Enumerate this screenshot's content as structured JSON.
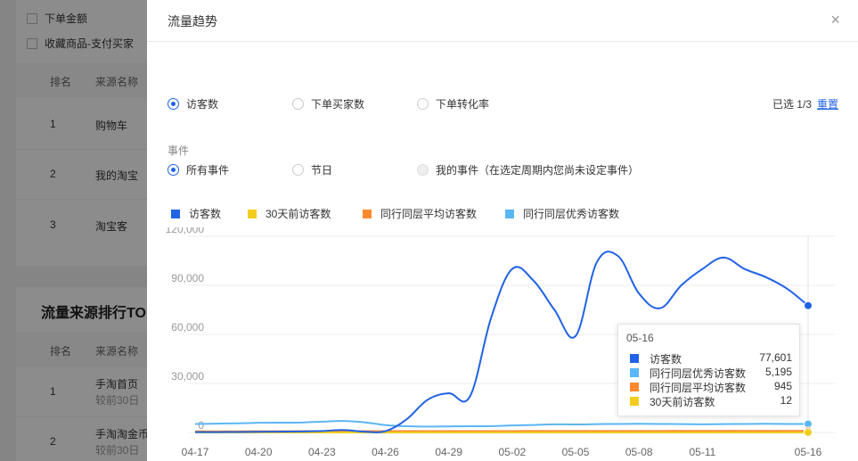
{
  "background": {
    "checkbox1": "下单金额",
    "checkbox2": "收藏商品-支付买家",
    "col_rank": "排名",
    "col_source": "来源名称",
    "rows1": [
      {
        "rank": "1",
        "name": "购物车"
      },
      {
        "rank": "2",
        "name": "我的淘宝"
      },
      {
        "rank": "3",
        "name": "淘宝客"
      }
    ],
    "section_title": "流量来源排行TO",
    "rows2": [
      {
        "rank": "1",
        "name": "手淘首页",
        "sub": "较前30日"
      },
      {
        "rank": "2",
        "name": "手淘淘金币",
        "sub": "较前30日"
      }
    ]
  },
  "modal": {
    "title": "流量趋势",
    "close": "×",
    "metrics": [
      {
        "label": "访客数",
        "checked": true
      },
      {
        "label": "下单买家数",
        "checked": false
      },
      {
        "label": "下单转化率",
        "checked": false
      }
    ],
    "selected_text": "已选 1/3",
    "reset_label": "重置",
    "event_label": "事件",
    "events": [
      {
        "label": "所有事件",
        "checked": true,
        "disabled": false
      },
      {
        "label": "节日",
        "checked": false,
        "disabled": false
      },
      {
        "label": "我的事件（在选定周期内您尚未设定事件）",
        "checked": false,
        "disabled": true
      }
    ]
  },
  "legend": [
    {
      "name": "访客数",
      "color": "#2062e6"
    },
    {
      "name": "30天前访客数",
      "color": "#f2cd1f"
    },
    {
      "name": "同行同层平均访客数",
      "color": "#fa8a2d"
    },
    {
      "name": "同行同层优秀访客数",
      "color": "#5bb6f5"
    }
  ],
  "chart_data": {
    "type": "line",
    "x": [
      "04-17",
      "04-18",
      "04-19",
      "04-20",
      "04-21",
      "04-22",
      "04-23",
      "04-24",
      "04-25",
      "04-26",
      "04-27",
      "04-28",
      "04-29",
      "04-30",
      "05-01",
      "05-02",
      "05-03",
      "05-04",
      "05-05",
      "05-06",
      "05-07",
      "05-08",
      "05-09",
      "05-10",
      "05-11",
      "05-12",
      "05-13",
      "05-14",
      "05-15",
      "05-16"
    ],
    "xticks": [
      "04-17",
      "04-20",
      "04-23",
      "04-26",
      "04-29",
      "05-02",
      "05-05",
      "05-08",
      "05-11",
      "05-16"
    ],
    "yticks": [
      "0",
      "30,000",
      "60,000",
      "90,000",
      "120,000"
    ],
    "ylim": [
      0,
      120000
    ],
    "series": [
      {
        "name": "访客数",
        "color": "#2062e6",
        "values": [
          200,
          200,
          300,
          400,
          500,
          600,
          900,
          1500,
          500,
          800,
          8000,
          20000,
          24000,
          22000,
          70000,
          100000,
          93000,
          75000,
          59000,
          104000,
          108000,
          85000,
          76000,
          90000,
          100000,
          107000,
          100000,
          95000,
          88000,
          77601
        ]
      },
      {
        "name": "30天前访客数",
        "color": "#f2cd1f",
        "values": [
          12,
          12,
          12,
          12,
          12,
          12,
          12,
          12,
          12,
          12,
          12,
          12,
          12,
          12,
          12,
          12,
          12,
          12,
          12,
          12,
          12,
          12,
          12,
          12,
          12,
          12,
          12,
          12,
          12,
          12
        ]
      },
      {
        "name": "同行同层平均访客数",
        "color": "#fa8a2d",
        "values": [
          700,
          700,
          700,
          750,
          750,
          800,
          800,
          800,
          800,
          800,
          800,
          820,
          820,
          830,
          830,
          850,
          870,
          880,
          890,
          900,
          910,
          920,
          920,
          930,
          930,
          940,
          940,
          945,
          945,
          945
        ]
      },
      {
        "name": "同行同层优秀访客数",
        "color": "#5bb6f5",
        "values": [
          5200,
          5400,
          5600,
          5900,
          6000,
          6100,
          6600,
          7000,
          6200,
          4500,
          3800,
          3600,
          3700,
          3800,
          3900,
          4300,
          4600,
          5000,
          4900,
          5100,
          5200,
          5300,
          5200,
          5100,
          5000,
          5100,
          5200,
          5300,
          5200,
          5195
        ]
      }
    ],
    "tooltip": {
      "date": "05-16",
      "rows": [
        {
          "name": "访客数",
          "value": "77,601",
          "color": "#2062e6"
        },
        {
          "name": "同行同层优秀访客数",
          "value": "5,195",
          "color": "#5bb6f5"
        },
        {
          "name": "同行同层平均访客数",
          "value": "945",
          "color": "#fa8a2d"
        },
        {
          "name": "30天前访客数",
          "value": "12",
          "color": "#f2cd1f"
        }
      ]
    }
  }
}
